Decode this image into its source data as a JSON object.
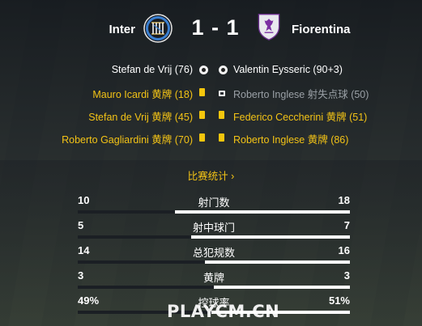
{
  "match": {
    "home_team": "Inter",
    "away_team": "Fiorentina",
    "score": "1 - 1",
    "colors": {
      "card_yellow": "#f4c60d",
      "text_yellow": "#f3c316",
      "muted_text": "#9aa0a6"
    }
  },
  "events": [
    {
      "home": "Stefan de Vrij (76)",
      "home_icon": "ball-icon",
      "away_icon": "ball-icon",
      "away": "Valentin Eysseric (90+3)",
      "home_style": "white",
      "away_style": "white"
    },
    {
      "home": "Mauro Icardi 黄牌 (18)",
      "home_icon": "yellow-card-icon",
      "away_icon": "penalty-miss-icon",
      "away": "Roberto Inglese 射失点球 (50)",
      "home_style": "yellow",
      "away_style": "grey"
    },
    {
      "home": "Stefan de Vrij 黄牌 (45)",
      "home_icon": "yellow-card-icon",
      "away_icon": "yellow-card-icon",
      "away": "Federico Ceccherini 黄牌 (51)",
      "home_style": "yellow",
      "away_style": "yellow"
    },
    {
      "home": "Roberto Gagliardini 黄牌 (70)",
      "home_icon": "yellow-card-icon",
      "away_icon": "yellow-card-icon",
      "away": "Roberto Inglese 黄牌 (86)",
      "home_style": "yellow",
      "away_style": "yellow"
    }
  ],
  "stats_link": "比赛统计 ›",
  "stats": [
    {
      "label": "射门数",
      "home": "10",
      "away": "18",
      "home_share": 0.357
    },
    {
      "label": "射中球门",
      "home": "5",
      "away": "7",
      "home_share": 0.417
    },
    {
      "label": "总犯规数",
      "home": "14",
      "away": "16",
      "home_share": 0.467
    },
    {
      "label": "黄牌",
      "home": "3",
      "away": "3",
      "home_share": 0.5
    },
    {
      "label": "控球率",
      "home": "49%",
      "away": "51%",
      "home_share": 0.49
    }
  ],
  "watermark": "PLAYCM.CN"
}
